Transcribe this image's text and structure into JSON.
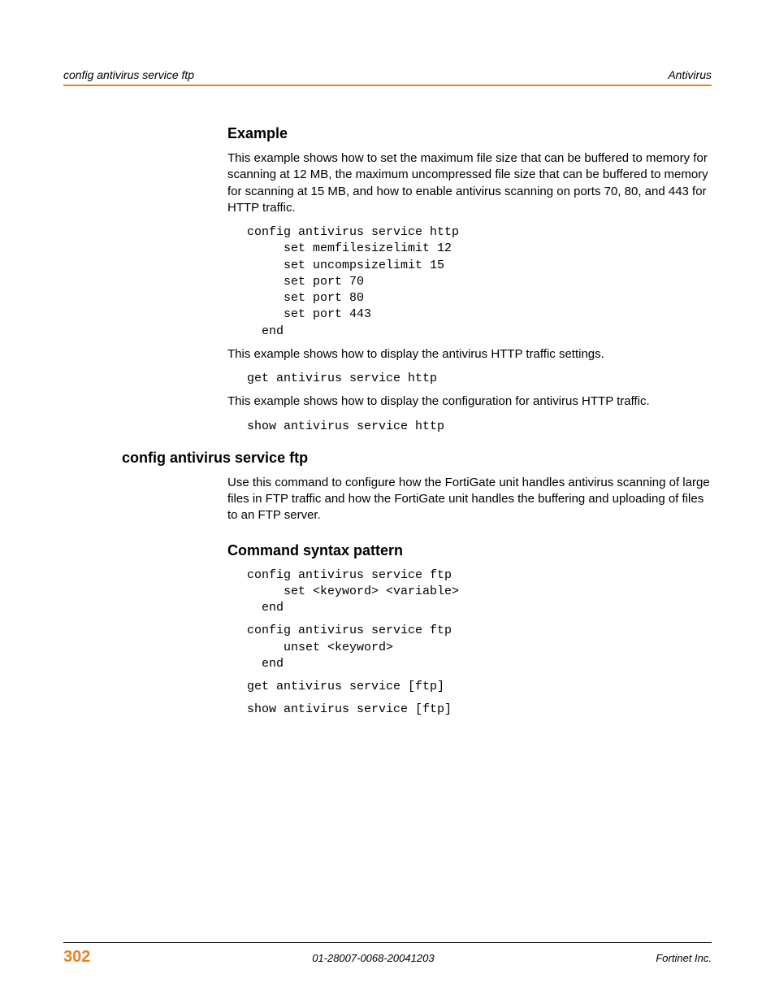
{
  "header": {
    "left": "config antivirus service ftp",
    "right": "Antivirus"
  },
  "section_example": {
    "title": "Example",
    "intro": "This example shows how to set the maximum file size that can be buffered to memory for scanning at 12 MB, the maximum uncompressed file size that can be buffered to memory for scanning at 15 MB, and how to enable antivirus scanning on ports 70, 80, and 443 for HTTP traffic.",
    "code1": "config antivirus service http\n     set memfilesizelimit 12\n     set uncompsizelimit 15\n     set port 70\n     set port 80\n     set port 443\n  end",
    "para2": "This example shows how to display the antivirus HTTP traffic settings.",
    "code2": "get antivirus service http",
    "para3": "This example shows how to display the configuration for antivirus HTTP traffic.",
    "code3": "show antivirus service http"
  },
  "section_ftp": {
    "title": "config antivirus service ftp",
    "intro": "Use this command to configure how the FortiGate unit handles antivirus scanning of large files in FTP traffic and how the FortiGate unit handles the buffering and uploading of files to an FTP server.",
    "syntax_title": "Command syntax pattern",
    "code1": "config antivirus service ftp\n     set <keyword> <variable>\n  end",
    "code2": "config antivirus service ftp\n     unset <keyword>\n  end",
    "code3": "get antivirus service [ftp]",
    "code4": "show antivirus service [ftp]"
  },
  "footer": {
    "page": "302",
    "doc_id": "01-28007-0068-20041203",
    "company": "Fortinet Inc."
  }
}
